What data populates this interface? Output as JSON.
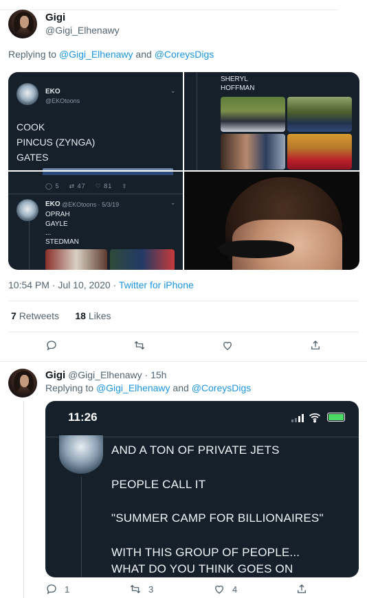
{
  "tweet1": {
    "name": "Gigi",
    "handle": "@Gigi_Elhenawy",
    "replying_prefix": "Replying to ",
    "replying_users": [
      "@Gigi_Elhenawy",
      "@CoreysDigs"
    ],
    "replying_and": " and ",
    "timestamp": "10:54 PM · Jul 10, 2020 · ",
    "source": "Twitter for iPhone",
    "retweets_count": "7",
    "retweets_label": "Retweets",
    "likes_count": "18",
    "likes_label": "Likes"
  },
  "media": {
    "cell1": {
      "author": "EKO",
      "handle": "@EKOtoons",
      "lines": [
        "COOK",
        "PINCUS (ZYNGA)",
        "GATES"
      ],
      "reply_count": "5",
      "retweet_count": "47",
      "like_count": "81"
    },
    "cell2": {
      "names": [
        "SHERYL",
        "HOFFMAN"
      ]
    },
    "cell3": {
      "author": "EKO",
      "handle_date": "@EKOtoons · 5/3/19",
      "lines": [
        "OPRAH",
        "GAYLE",
        "...",
        "STEDMAN"
      ]
    }
  },
  "tweet2": {
    "name": "Gigi",
    "handle_time": "@Gigi_Elhenawy · 15h",
    "replying_prefix": "Replying to ",
    "replying_users": [
      "@Gigi_Elhenawy",
      "@CoreysDigs"
    ],
    "replying_and": " and ",
    "screenshot": {
      "clock": "11:26",
      "lines": [
        "AND A TON OF PRIVATE JETS",
        "PEOPLE CALL IT",
        "\"SUMMER CAMP FOR BILLIONAIRES\"",
        "WITH THIS GROUP OF PEOPLE...",
        "WHAT DO YOU THINK GOES ON"
      ]
    },
    "reply_count": "1",
    "retweet_count": "3",
    "like_count": "4"
  },
  "colors": {
    "link": "#1b95e0",
    "muted": "#536471",
    "dark_bg": "#15202b"
  }
}
